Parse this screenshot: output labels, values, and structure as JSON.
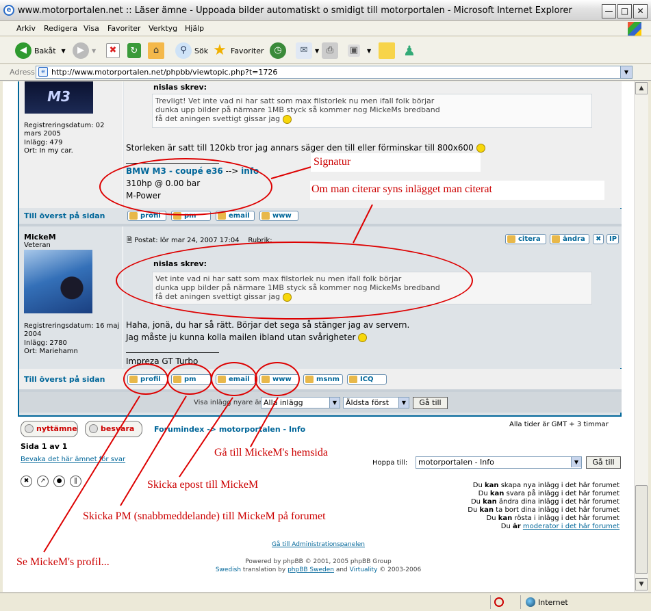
{
  "window": {
    "title": "www.motorportalen.net :: Läser ämne - Uppoada bilder automatiskt o smidigt till motorportalen - Microsoft Internet Explorer"
  },
  "menu": [
    "Arkiv",
    "Redigera",
    "Visa",
    "Favoriter",
    "Verktyg",
    "Hjälp"
  ],
  "toolbar": {
    "back": "Bakåt",
    "search": "Sök",
    "favorites": "Favoriter"
  },
  "address": {
    "label": "Adress",
    "url": "http://www.motorportalen.net/phpbb/viewtopic.php?t=1726"
  },
  "post1": {
    "reg_date": "Registreringsdatum: 02 mars 2005",
    "posts": "Inlägg: 479",
    "location": "Ort: In my car.",
    "quote_head": "nislas skrev:",
    "quote_lines": [
      "Trevligt! Vet inte vad ni har satt som max filstorlek nu men ifall folk börjar",
      "dunka upp bilder på närmare 1MB styck så kommer nog MickeMs bredband",
      "få det aningen svettigt gissar jag"
    ],
    "body": "Storleken är satt till 120kb tror jag annars säger den till eller förminskar till 800x600",
    "sig_car": "BMW M3 - coupé e36",
    "sig_arrow": "-->",
    "sig_info": "info",
    "sig_line2": "310hp @ 0.00 bar",
    "sig_line3": "M-Power",
    "top_link": "Till överst på sidan",
    "buttons": [
      "profil",
      "pm",
      "email",
      "www"
    ]
  },
  "post2": {
    "author": "MickeM",
    "rank": "Veteran",
    "posted": "Postat: lör mar 24, 2007 17:04",
    "subject_fragment": "Rubrik:",
    "quote_btn": "citera",
    "edit_btn": "ändra",
    "ip_btn": "IP",
    "reg_date": "Registreringsdatum: 16 maj 2004",
    "posts": "Inlägg: 2780",
    "location": "Ort: Mariehamn",
    "quote_head": "nislas skrev:",
    "quote_lines": [
      "Vet inte vad ni har satt som max filstorlek nu men ifall folk börjar",
      "dunka upp bilder på närmare 1MB styck så kommer nog MickeMs bredband",
      "få det aningen svettigt gissar jag"
    ],
    "body_line1": "Haha, jonä, du har så rätt. Börjar det sega så stänger jag av servern.",
    "body_line2": "Jag måste ju kunna kolla mailen ibland utan svårigheter",
    "sig": "Impreza GT Turbo",
    "top_link": "Till överst på sidan",
    "buttons": [
      "profil",
      "pm",
      "email",
      "www",
      "msnm",
      "ICQ"
    ]
  },
  "filter": {
    "label": "Visa inlägg nyare än:",
    "all": "Alla inlägg",
    "order": "Äldsta först",
    "go": "Gå till"
  },
  "nav": {
    "new_topic": "nyttämne",
    "reply": "besvara",
    "forumindex": "Forumindex",
    "sep": "->",
    "forum": "motorportalen - Info",
    "timezone": "Alla tider är GMT + 3 timmar",
    "page": "Sida 1 av 1",
    "watch": "Bevaka det här ämnet för svar",
    "jump_label": "Hoppa till:",
    "jump_value": "motorportalen - Info",
    "jump_go": "Gå till"
  },
  "perms": [
    {
      "pre": "Du ",
      "kan": "kan",
      "post": " skapa nya inlägg i det här forumet"
    },
    {
      "pre": "Du ",
      "kan": "kan",
      "post": " svara på inlägg i det här forumet"
    },
    {
      "pre": "Du ",
      "kan": "kan",
      "post": " ändra dina inlägg i det här forumet"
    },
    {
      "pre": "Du ",
      "kan": "kan",
      "post": " ta bort dina inlägg i det här forumet"
    },
    {
      "pre": "Du ",
      "kan": "kan",
      "post": " rösta i inlägg i det här forumet"
    }
  ],
  "moderator": {
    "pre": "Du ",
    "ar": "är",
    "link": "moderator i det här forumet"
  },
  "footer": {
    "admin": "Gå till Administrationspanelen",
    "powered": "Powered by phpBB © 2001, 2005 phpBB Group",
    "swedish": "Swedish",
    "translation": " translation by ",
    "phpbbse": "phpBB Sweden",
    "and": " and ",
    "virtuality": "Virtuality",
    "years": " © 2003-2006"
  },
  "annotations": {
    "signatur": "Signatur",
    "quote_note": "Om man citerar syns inlägget man citerat",
    "www_note": "Gå till MickeM's hemsida",
    "email_note": "Skicka epost till MickeM",
    "pm_note": "Skicka PM (snabbmeddelande) till MickeM på forumet",
    "profile_note": "Se MickeM's profil..."
  },
  "status": {
    "zone": "Internet"
  }
}
